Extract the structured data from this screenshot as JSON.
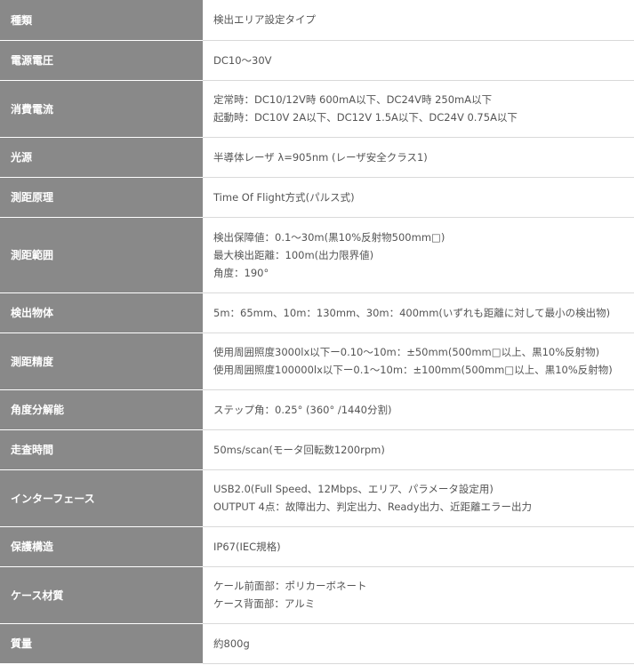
{
  "rows": [
    {
      "label": "種類",
      "lines": [
        "検出エリア設定タイプ"
      ]
    },
    {
      "label": "電源電圧",
      "lines": [
        "DC10～30V"
      ]
    },
    {
      "label": "消費電流",
      "lines": [
        "定常時：DC10/12V時 600mA以下、DC24V時 250mA以下",
        "起動時：DC10V 2A以下、DC12V 1.5A以下、DC24V 0.75A以下"
      ]
    },
    {
      "label": "光源",
      "lines": [
        "半導体レーザ λ=905nm (レーザ安全クラス1)"
      ]
    },
    {
      "label": "測距原理",
      "lines": [
        "Time Of Flight方式(パルス式)"
      ]
    },
    {
      "label": "測距範囲",
      "lines": [
        "検出保障値：0.1～30m(黒10%反射物500mm□)",
        "最大検出距離：100m(出力限界値)",
        "角度：190°"
      ]
    },
    {
      "label": "検出物体",
      "lines": [
        "5m：65mm、10m：130mm、30m：400mm(いずれも距離に対して最小の検出物)"
      ]
    },
    {
      "label": "測距精度",
      "lines": [
        "使用周囲照度3000lx以下ー0.10～10m：±50mm(500mm□以上、黒10%反射物)",
        "使用周囲照度100000lx以下ー0.1～10m：±100mm(500mm□以上、黒10%反射物)"
      ]
    },
    {
      "label": "角度分解能",
      "lines": [
        "ステップ角：0.25° (360° /1440分割)"
      ]
    },
    {
      "label": "走査時間",
      "lines": [
        "50ms/scan(モータ回転数1200rpm)"
      ]
    },
    {
      "label": "インターフェース",
      "lines": [
        "USB2.0(Full Speed、12Mbps、エリア、パラメータ設定用)",
        "OUTPUT 4点：故障出力、判定出力、Ready出力、近距離エラー出力"
      ]
    },
    {
      "label": "保護構造",
      "lines": [
        "IP67(IEC規格)"
      ]
    },
    {
      "label": "ケース材質",
      "lines": [
        "ケール前面部：ポリカーボネート",
        "ケース背面部：アルミ"
      ]
    },
    {
      "label": "質量",
      "lines": [
        "約800g"
      ]
    }
  ]
}
